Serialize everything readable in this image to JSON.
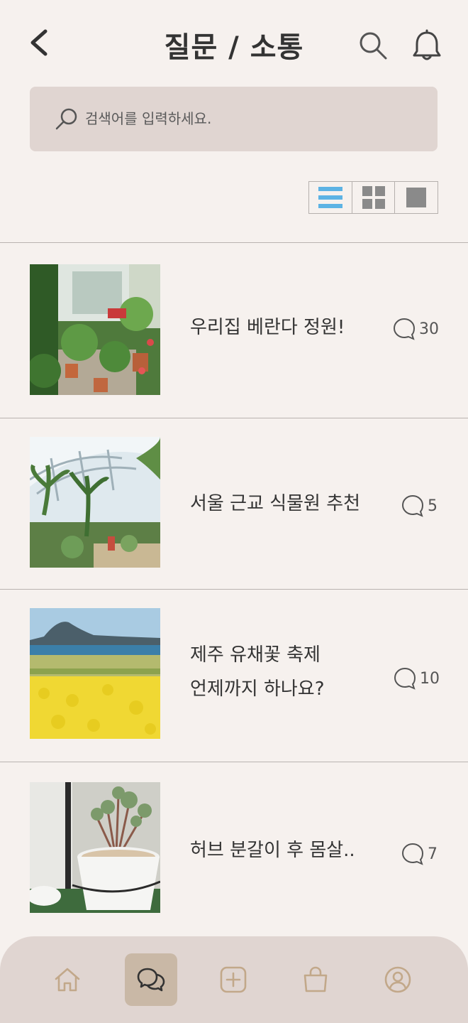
{
  "header": {
    "title": "질문 / 소통",
    "back_icon": "chevron-left-icon",
    "search_icon": "search-icon",
    "bell_icon": "bell-icon"
  },
  "search": {
    "placeholder": "검색어를 입력하세요.",
    "value": ""
  },
  "view_toggle": {
    "options": [
      "list",
      "grid",
      "single"
    ],
    "selected": "list",
    "active_color": "#5db3e4",
    "inactive_color": "#8a8a8a"
  },
  "posts": [
    {
      "title_lines": [
        "우리집 베란다 정원!"
      ],
      "comment_count": "30",
      "image": "balcony-garden"
    },
    {
      "title_lines": [
        "서울 근교 식물원 추천"
      ],
      "comment_count": "5",
      "image": "botanical-garden"
    },
    {
      "title_lines": [
        "제주 유채꽃 축제",
        "언제까지 하나요?"
      ],
      "comment_count": "10",
      "image": "canola-field"
    },
    {
      "title_lines": [
        "허브 분갈이 후 몸살.."
      ],
      "comment_count": "7",
      "image": "potted-herb"
    }
  ],
  "bottom_nav": {
    "items": [
      "home-icon",
      "chat-icon",
      "add-icon",
      "shopping-bag-icon",
      "profile-icon"
    ],
    "active": "chat-icon"
  },
  "colors": {
    "background": "#f6f1ee",
    "search_bg": "#e0d5d1",
    "nav_bg": "#e0d5d1",
    "nav_active": "#c9b8a6",
    "nav_icon": "#c2a88a"
  }
}
